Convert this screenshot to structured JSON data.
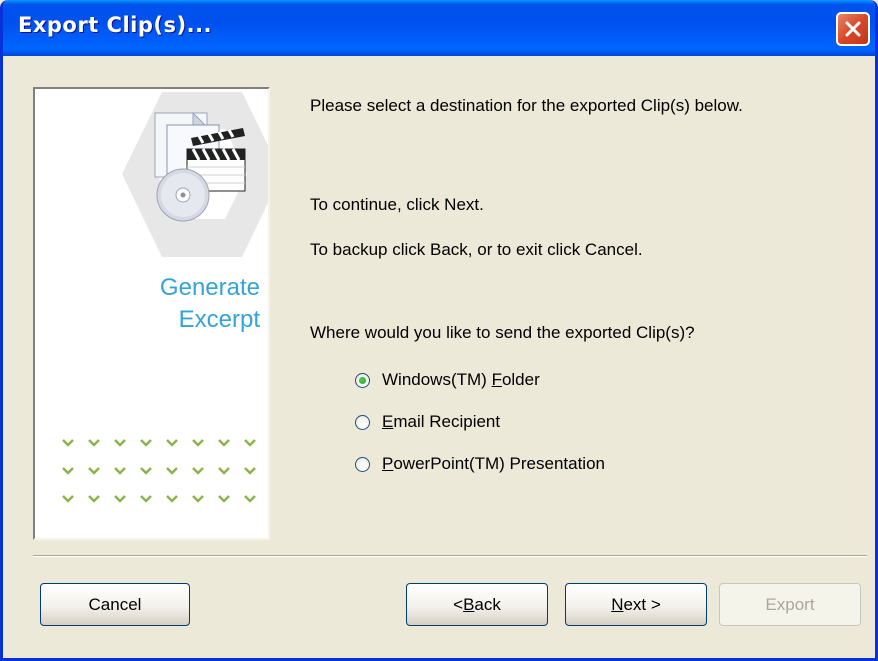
{
  "window": {
    "title": "Export Clip(s)..."
  },
  "side_panel": {
    "title_line1": "Generate",
    "title_line2": "Excerpt"
  },
  "main": {
    "intro": "Please select a destination for the exported Clip(s) below.",
    "continue_text": "To continue, click Next.",
    "back_text": "To backup click Back, or to exit click Cancel.",
    "question": "Where would you like to send the exported Clip(s)?"
  },
  "options": [
    {
      "pre": "Windows(TM) ",
      "key": "F",
      "post": "older",
      "checked": true
    },
    {
      "pre": "",
      "key": "E",
      "post": "mail Recipient",
      "checked": false
    },
    {
      "pre": "",
      "key": "P",
      "post": "owerPoint(TM) Presentation",
      "checked": false
    }
  ],
  "buttons": {
    "cancel": "Cancel",
    "back": {
      "pre": "< ",
      "key": "B",
      "post": "ack"
    },
    "next": {
      "key": "N",
      "post": "ext >"
    },
    "export": "Export"
  },
  "colors": {
    "accent": "#33a3dc",
    "titlebar": "#0053ee",
    "dots": "#8cb44a"
  }
}
